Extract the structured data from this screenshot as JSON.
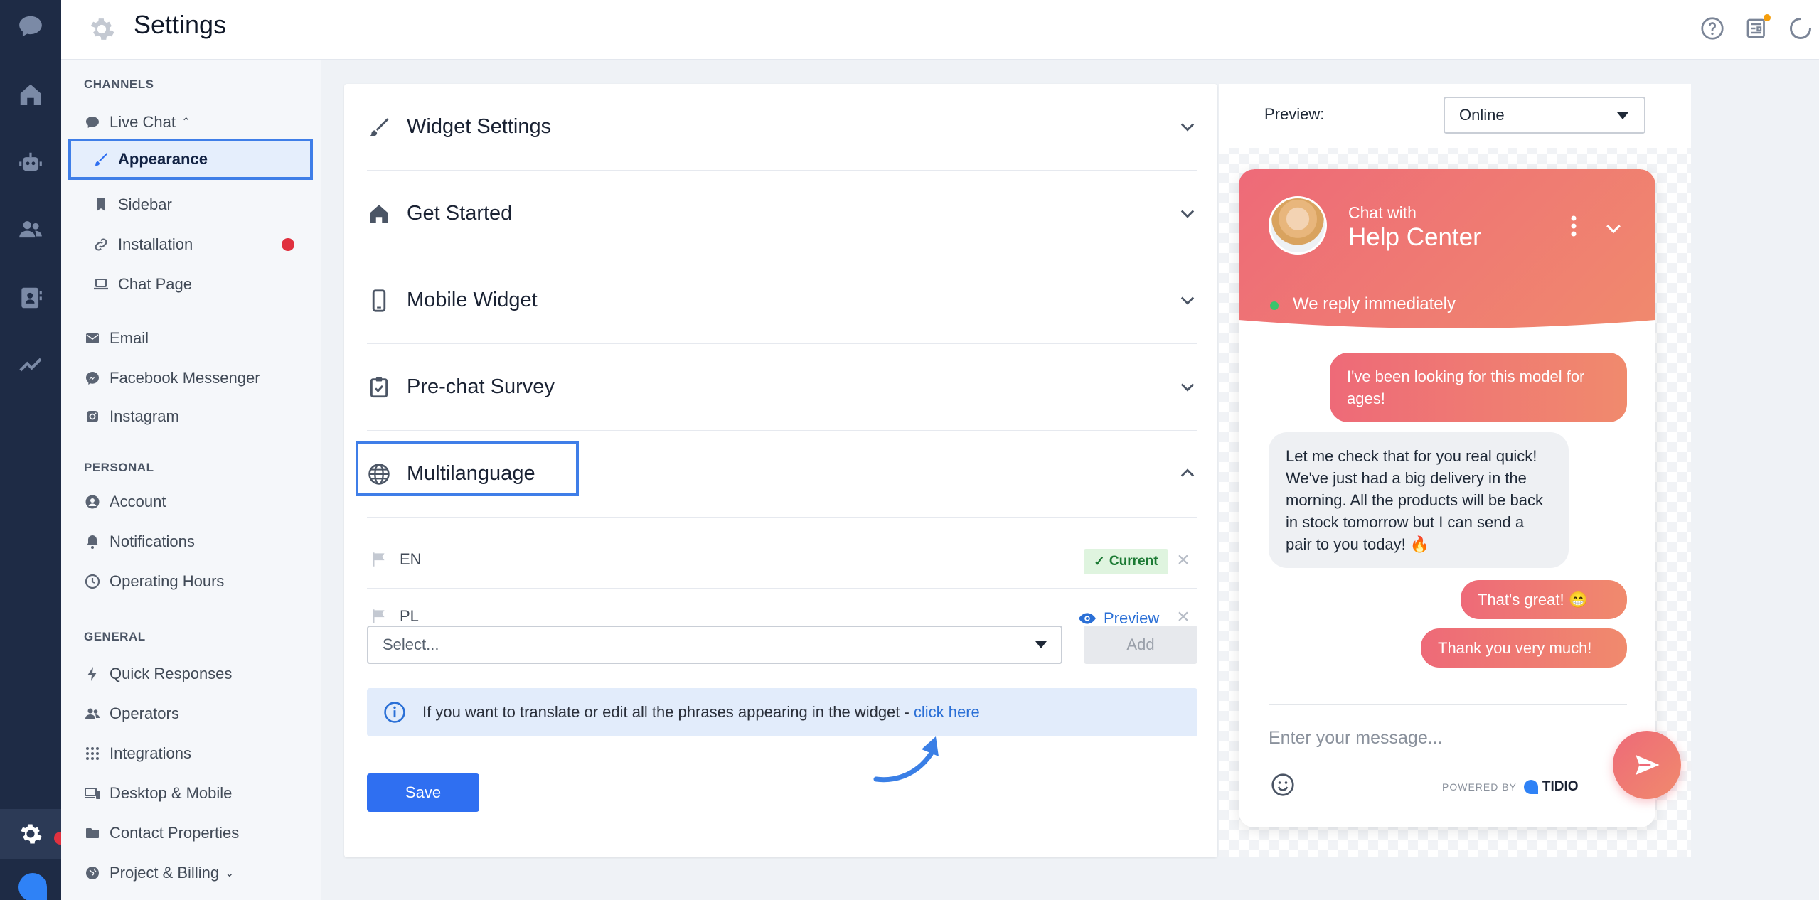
{
  "app": {
    "title": "Settings"
  },
  "sidebar": {
    "sections": {
      "channels": "CHANNELS",
      "personal": "PERSONAL",
      "general": "GENERAL"
    },
    "live_chat": "Live Chat",
    "live_chat_items": [
      "Appearance",
      "Sidebar",
      "Installation",
      "Chat Page"
    ],
    "channel_items": [
      "Email",
      "Facebook Messenger",
      "Instagram"
    ],
    "personal_items": [
      "Account",
      "Notifications",
      "Operating Hours"
    ],
    "general_items": [
      "Quick Responses",
      "Operators",
      "Integrations",
      "Desktop & Mobile",
      "Contact Properties",
      "Project & Billing"
    ]
  },
  "settings": {
    "panels": [
      "Widget Settings",
      "Get Started",
      "Mobile Widget",
      "Pre-chat Survey",
      "Multilanguage"
    ],
    "languages": [
      {
        "code": "EN",
        "status": "Current"
      },
      {
        "code": "PL",
        "action": "Preview"
      }
    ],
    "select_placeholder": "Select...",
    "add_label": "Add",
    "info_text": "If you want to translate or edit all the phrases appearing in the widget - ",
    "info_link": "click here",
    "save_label": "Save"
  },
  "preview": {
    "label": "Preview:",
    "mode": "Online",
    "widget": {
      "subtitle": "Chat with",
      "title": "Help Center",
      "status": "We reply immediately",
      "messages": [
        {
          "from": "visitor",
          "text": "I've been looking for this model for ages!"
        },
        {
          "from": "operator",
          "text": "Let me check that for you real quick! We've just had a big delivery in the morning. All the products will be back in stock tomorrow but I can send a pair to you today! 🔥"
        },
        {
          "from": "visitor",
          "text": "That's great! 😁"
        },
        {
          "from": "visitor",
          "text": "Thank you very much!"
        }
      ],
      "composer_placeholder": "Enter your message...",
      "powered_by": "POWERED BY",
      "brand": "TIDIO"
    }
  },
  "colors": {
    "accent": "#2f6ff1",
    "rail": "#1e2b45",
    "widget_gradient_start": "#ee6a78",
    "widget_gradient_end": "#f08a6d",
    "alert": "#e0313f"
  }
}
